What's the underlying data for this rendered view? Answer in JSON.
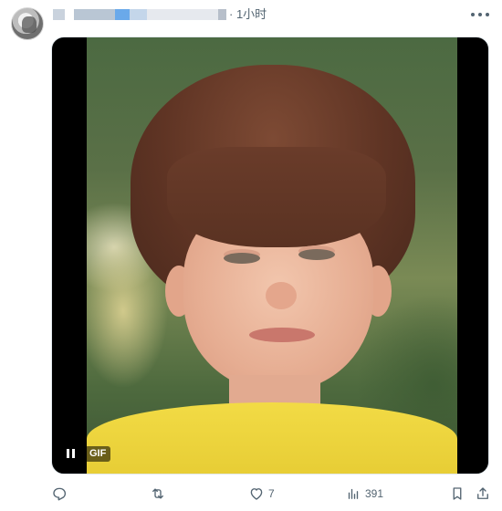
{
  "post": {
    "timestamp": "· 1小时",
    "media": {
      "type": "GIF",
      "badge": "GIF",
      "control_icon": "pause-icon"
    },
    "actions": {
      "reply": {
        "icon": "reply-icon",
        "count": ""
      },
      "retweet": {
        "icon": "retweet-icon",
        "count": ""
      },
      "like": {
        "icon": "heart-icon",
        "count": "7"
      },
      "views": {
        "icon": "views-chart-icon",
        "count": "391"
      },
      "bookmark": {
        "icon": "bookmark-icon"
      },
      "share": {
        "icon": "share-icon"
      }
    }
  },
  "colors": {
    "secondary_text": "#536471",
    "media_background": "#000000",
    "shirt_yellow": "#f2db45"
  }
}
